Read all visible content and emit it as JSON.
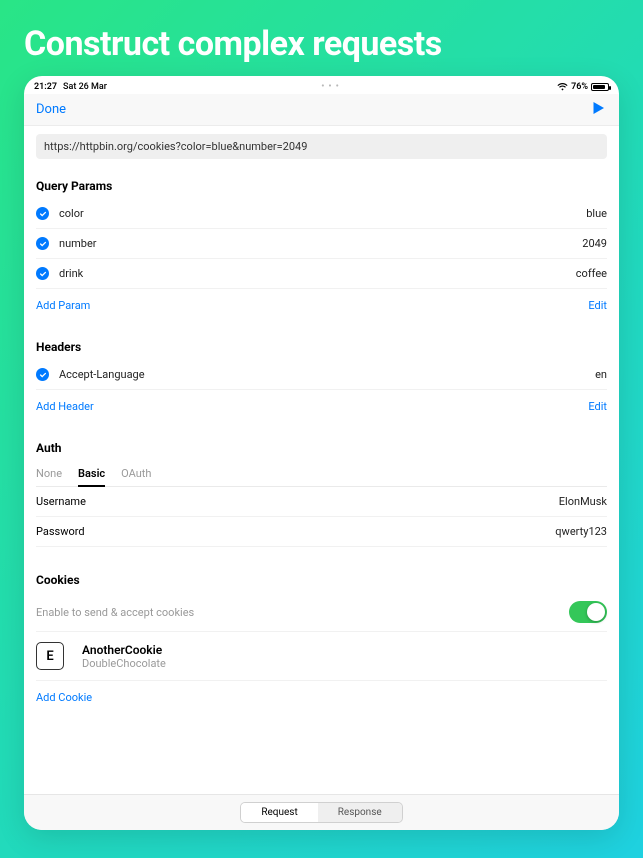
{
  "hero": "Construct complex requests",
  "statusbar": {
    "time": "21:27",
    "date": "Sat 26 Mar",
    "battery_pct": "76%"
  },
  "nav": {
    "done": "Done"
  },
  "url": "https://httpbin.org/cookies?color=blue&number=2049",
  "queryParams": {
    "title": "Query Params",
    "items": [
      {
        "key": "color",
        "value": "blue"
      },
      {
        "key": "number",
        "value": "2049"
      },
      {
        "key": "drink",
        "value": "coffee"
      }
    ],
    "add": "Add Param",
    "edit": "Edit"
  },
  "headers": {
    "title": "Headers",
    "items": [
      {
        "key": "Accept-Language",
        "value": "en"
      }
    ],
    "add": "Add Header",
    "edit": "Edit"
  },
  "auth": {
    "title": "Auth",
    "tabs": [
      "None",
      "Basic",
      "OAuth"
    ],
    "selected": "Basic",
    "usernameLabel": "Username",
    "username": "ElonMusk",
    "passwordLabel": "Password",
    "password": "qwerty123"
  },
  "cookies": {
    "title": "Cookies",
    "description": "Enable to send & accept cookies",
    "item": {
      "iconLetter": "E",
      "name": "AnotherCookie",
      "value": "DoubleChocolate"
    },
    "add": "Add Cookie"
  },
  "bottom": {
    "request": "Request",
    "response": "Response"
  }
}
